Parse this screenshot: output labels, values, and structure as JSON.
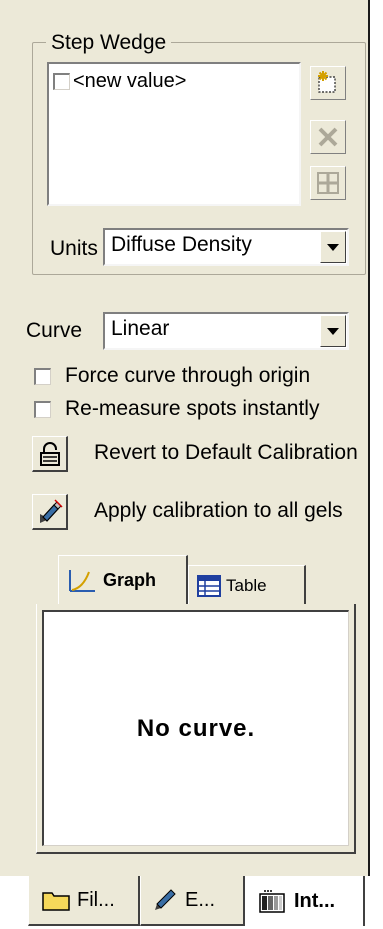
{
  "step_wedge": {
    "group_label": "Step Wedge",
    "items": [
      {
        "label": "<new value>",
        "checked": false
      }
    ],
    "buttons": [
      {
        "name": "new-value-icon",
        "enabled": true
      },
      {
        "name": "delete-icon",
        "enabled": false
      },
      {
        "name": "grid-icon",
        "enabled": false
      }
    ],
    "units_label": "Units",
    "units_value": "Diffuse Density"
  },
  "curve": {
    "label": "Curve",
    "value": "Linear"
  },
  "options": {
    "force_origin": {
      "label": "Force curve through origin",
      "checked": false
    },
    "remeasure": {
      "label": "Re-measure spots instantly",
      "checked": false
    }
  },
  "actions": {
    "revert_label": "Revert to Default Calibration",
    "apply_label": "Apply calibration to all gels"
  },
  "view_tabs": {
    "graph_label": "Graph",
    "table_label": "Table",
    "active": "graph"
  },
  "graph": {
    "message": "No curve."
  },
  "bottom_tabs": [
    {
      "label": "Fil...",
      "icon": "folder-icon"
    },
    {
      "label": "E...",
      "icon": "pen-icon"
    },
    {
      "label": "Int...",
      "icon": "density-icon",
      "active": true
    }
  ],
  "colors": {
    "panel": "#ece9d8",
    "border_dark": "#404040"
  }
}
